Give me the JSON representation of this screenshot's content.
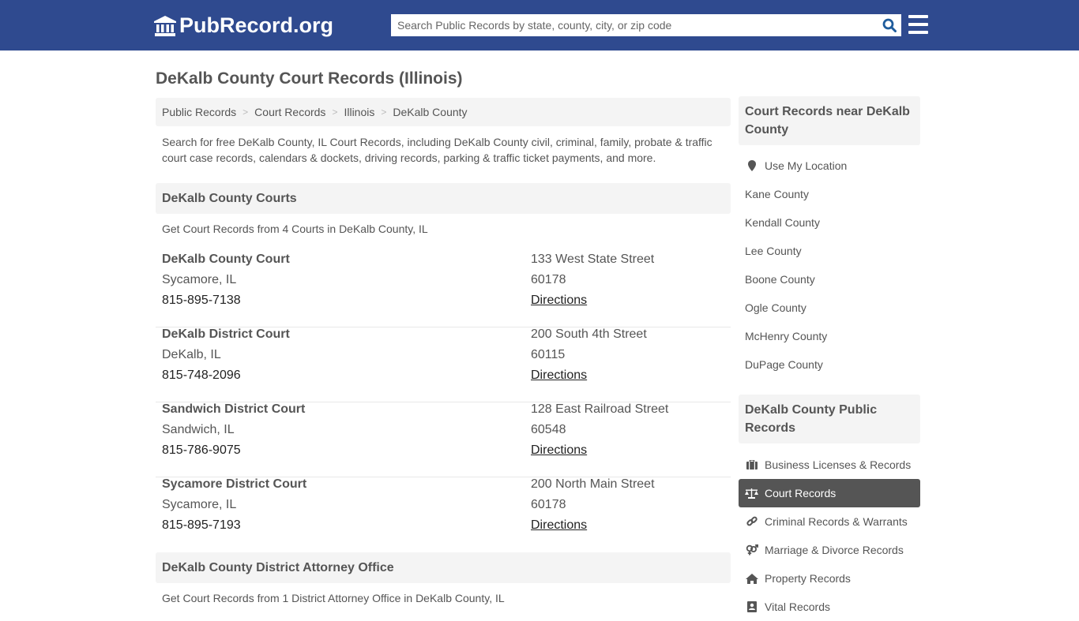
{
  "header": {
    "logo_text": "PubRecord.org",
    "search_placeholder": "Search Public Records by state, county, city, or zip code"
  },
  "page_title": "DeKalb County Court Records (Illinois)",
  "breadcrumb": [
    "Public Records",
    "Court Records",
    "Illinois",
    "DeKalb County"
  ],
  "intro": "Search for free DeKalb County, IL Court Records, including DeKalb County civil, criminal, family, probate & traffic court case records, calendars & dockets, driving records, parking & traffic ticket payments, and more.",
  "courts_section": {
    "title": "DeKalb County Courts",
    "subtitle": "Get Court Records from 4 Courts in DeKalb County, IL",
    "items": [
      {
        "name": "DeKalb County Court",
        "city": "Sycamore, IL",
        "phone": "815-895-7138",
        "street": "133 West State Street",
        "zip": "60178",
        "directions": "Directions"
      },
      {
        "name": "DeKalb District Court",
        "city": "DeKalb, IL",
        "phone": "815-748-2096",
        "street": "200 South 4th Street",
        "zip": "60115",
        "directions": "Directions"
      },
      {
        "name": "Sandwich District Court",
        "city": "Sandwich, IL",
        "phone": "815-786-9075",
        "street": "128 East Railroad Street",
        "zip": "60548",
        "directions": "Directions"
      },
      {
        "name": "Sycamore District Court",
        "city": "Sycamore, IL",
        "phone": "815-895-7193",
        "street": "200 North Main Street",
        "zip": "60178",
        "directions": "Directions"
      }
    ]
  },
  "da_section": {
    "title": "DeKalb County District Attorney Office",
    "subtitle": "Get Court Records from 1 District Attorney Office in DeKalb County, IL"
  },
  "sidebar": {
    "nearby": {
      "title": "Court Records near DeKalb County",
      "use_location": "Use My Location",
      "counties": [
        "Kane County",
        "Kendall County",
        "Lee County",
        "Boone County",
        "Ogle County",
        "McHenry County",
        "DuPage County"
      ]
    },
    "public_records": {
      "title": "DeKalb County Public Records",
      "items": [
        {
          "label": "Business Licenses & Records",
          "icon": "briefcase-icon",
          "active": false
        },
        {
          "label": "Court Records",
          "icon": "scale-icon",
          "active": true
        },
        {
          "label": "Criminal Records & Warrants",
          "icon": "link-icon",
          "active": false
        },
        {
          "label": "Marriage & Divorce Records",
          "icon": "venus-mars-icon",
          "active": false
        },
        {
          "label": "Property Records",
          "icon": "home-icon",
          "active": false
        },
        {
          "label": "Vital Records",
          "icon": "id-card-icon",
          "active": false
        }
      ]
    }
  },
  "colors": {
    "header_bg": "#2f4a8f",
    "search_icon": "#1f5c9c",
    "active_item_bg": "#555555",
    "section_bg": "#f4f4f4"
  }
}
